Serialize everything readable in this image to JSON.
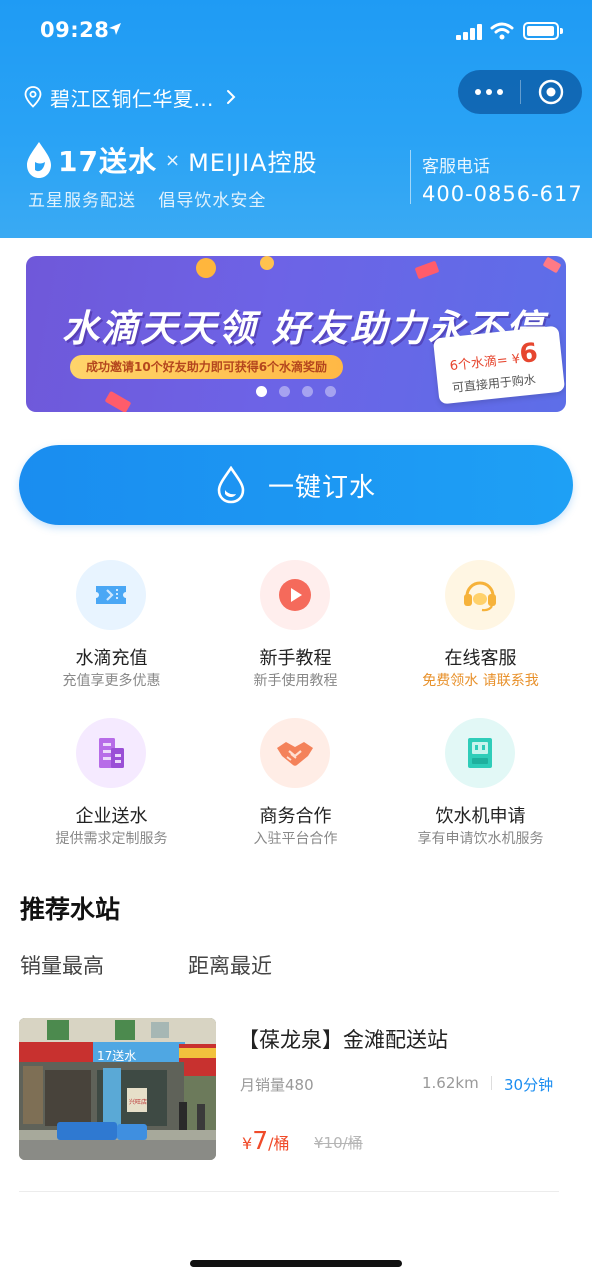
{
  "status_bar": {
    "time": "09:28"
  },
  "header": {
    "location": "碧江区铜仁华夏…",
    "brand": {
      "name": "17送水",
      "separator": "×",
      "partner": "MEIJIA控股"
    },
    "slogans": [
      "五星服务配送",
      "倡导饮水安全"
    ],
    "hotline": {
      "label": "客服电话",
      "number": "400-0856-617"
    }
  },
  "banner": {
    "title": "水滴天天领  好友助力永不停",
    "subtitle": "成功邀请10个好友助力即可获得6个水滴奖励",
    "card_prefix": "6个水滴= ¥",
    "card_amount": "6",
    "card_note": "可直接用于购水",
    "slide_count": 4,
    "active_slide": 1
  },
  "order_button": {
    "label": "一键订水"
  },
  "features": [
    {
      "title": "水滴充值",
      "subtitle": "充值享更多优惠",
      "icon": "ticket-icon"
    },
    {
      "title": "新手教程",
      "subtitle": "新手使用教程",
      "icon": "play-icon"
    },
    {
      "title": "在线客服",
      "subtitle": "免费领水 请联系我",
      "icon": "headset-icon"
    },
    {
      "title": "企业送水",
      "subtitle": "提供需求定制服务",
      "icon": "building-icon"
    },
    {
      "title": "商务合作",
      "subtitle": "入驻平台合作",
      "icon": "handshake-icon"
    },
    {
      "title": "饮水机申请",
      "subtitle": "享有申请饮水机服务",
      "icon": "dispenser-icon"
    }
  ],
  "recommend": {
    "title": "推荐水站",
    "tabs": [
      "销量最高",
      "距离最近"
    ],
    "station": {
      "name": "【葆龙泉】金滩配送站",
      "sales": "月销量480",
      "distance": "1.62km",
      "delivery_time": "30分钟",
      "price_symbol": "¥",
      "price": "7",
      "price_unit": "/桶",
      "original_price": "¥10/桶",
      "photo_sign": "17送水",
      "photo_side_sign": "兴旺店"
    }
  },
  "colors": {
    "primary": "#1a8df0",
    "price": "#f04b2a",
    "highlight": "#e8912b"
  }
}
